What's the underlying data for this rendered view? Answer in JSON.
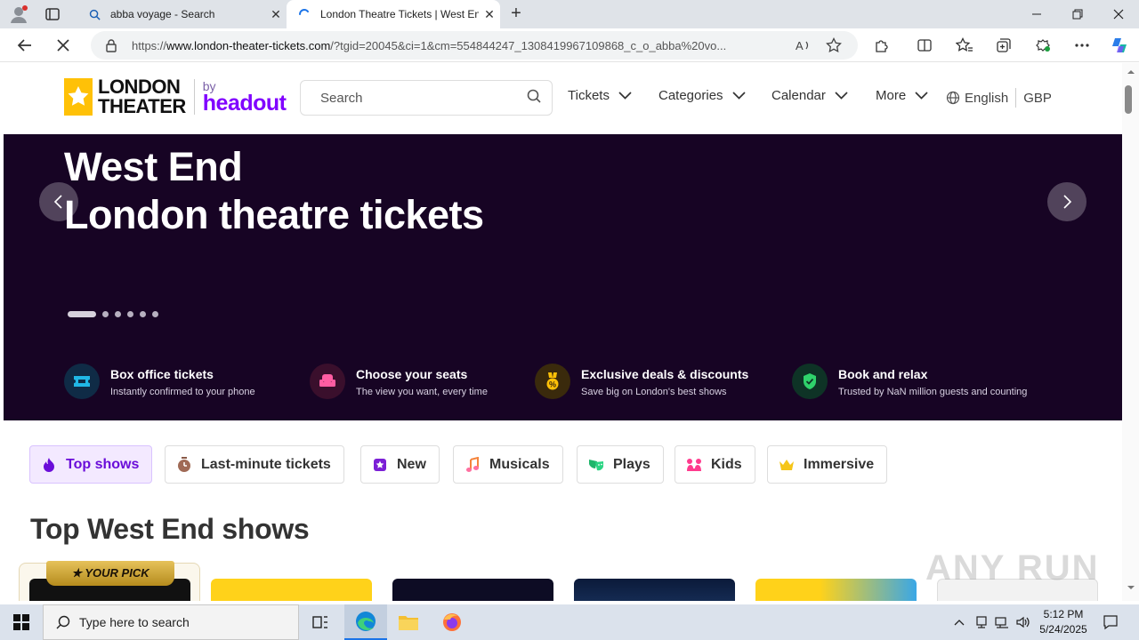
{
  "browser": {
    "tabs": [
      {
        "title": "abba voyage - Search"
      },
      {
        "title": "London Theatre Tickets | West End"
      }
    ],
    "url_prefix": "https://",
    "url_host": "www.london-theater-tickets.com",
    "url_rest": "/?tgid=20045&ci=1&cm=554844247_1308419967109868_c_o_abba%20vo..."
  },
  "header": {
    "logo_line1": "LONDON",
    "logo_line2": "THEATER",
    "logo_by": "by",
    "logo_brand": "headout",
    "search_placeholder": "Search",
    "nav": [
      "Tickets",
      "Categories",
      "Calendar",
      "More"
    ],
    "language": "English",
    "currency": "GBP"
  },
  "hero": {
    "title_line1": "West End",
    "title_line2": "London theatre tickets",
    "slides_count": 6,
    "active_slide": 1,
    "features": [
      {
        "title": "Box office tickets",
        "subtitle": "Instantly confirmed to your phone",
        "icon": "ticket-icon"
      },
      {
        "title": "Choose your seats",
        "subtitle": "The view you want, every time",
        "icon": "seat-icon"
      },
      {
        "title": "Exclusive deals & discounts",
        "subtitle": "Save big on London's best shows",
        "icon": "medal-icon"
      },
      {
        "title": "Book and relax",
        "subtitle": "Trusted by NaN million guests and counting",
        "icon": "shield-check-icon"
      }
    ]
  },
  "categories": [
    {
      "label": "Top shows",
      "icon": "flame-icon",
      "active": true
    },
    {
      "label": "Last-minute tickets",
      "icon": "clock-icon",
      "active": false
    },
    {
      "label": "New",
      "icon": "star-badge-icon",
      "active": false
    },
    {
      "label": "Musicals",
      "icon": "music-note-icon",
      "active": false
    },
    {
      "label": "Plays",
      "icon": "masks-icon",
      "active": false
    },
    {
      "label": "Kids",
      "icon": "kids-icon",
      "active": false
    },
    {
      "label": "Immersive",
      "icon": "crown-icon",
      "active": false
    }
  ],
  "section": {
    "title": "Top West End shows",
    "your_pick_label": "★ YOUR PICK"
  },
  "watermark": "ANY RUN",
  "taskbar": {
    "search_placeholder": "Type here to search",
    "time": "5:12 PM",
    "date": "5/24/2025"
  },
  "colors": {
    "hero_bg": "#170424",
    "brand_purple": "#8000ff",
    "logo_yellow": "#ffc107",
    "active_chip_bg": "#f3e9ff"
  }
}
